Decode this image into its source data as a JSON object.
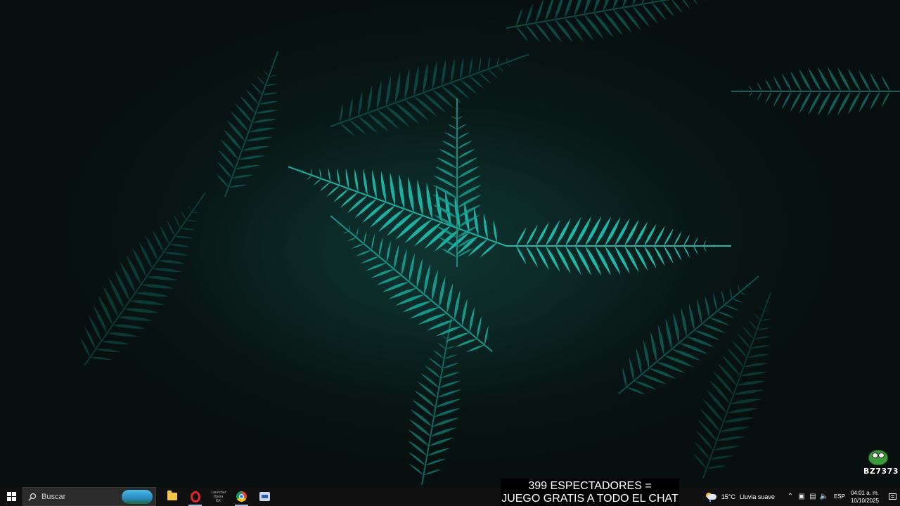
{
  "taskbar": {
    "search_placeholder": "Buscar",
    "pinned_apps": [
      "file-explorer",
      "opera-gx",
      "opera-launcher",
      "chrome",
      "microsoft-store"
    ],
    "app_gx_label": "Launcher Opera GX"
  },
  "overlay": {
    "line1": "399 ESPECTADORES =",
    "line2": "JUEGO GRATIS A TODO EL CHAT"
  },
  "watermark": {
    "text": "BZ7373"
  },
  "tray": {
    "weather_temp": "15°C",
    "weather_desc": "Lluvia suave",
    "language": "ESP",
    "time": "04:01 a. m.",
    "date": "10/10/2025"
  },
  "colors": {
    "taskbar_bg": "#101010",
    "fern": "#1fbfb0",
    "desktop_bg": "#0b1a18"
  }
}
